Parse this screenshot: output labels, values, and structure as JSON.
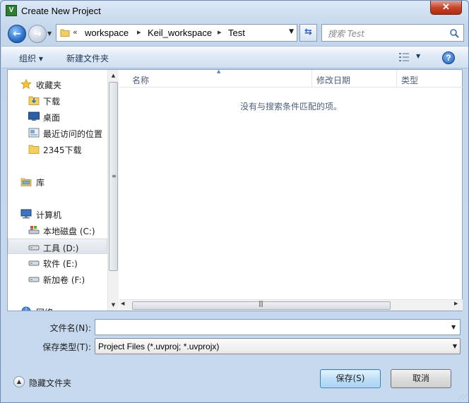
{
  "window": {
    "title": "Create New Project",
    "app_icon_text": "V",
    "close_label": "✕"
  },
  "navbar": {
    "breadcrumb_prefix": "«",
    "crumbs": [
      "workspace",
      "Keil_workspace",
      "Test"
    ],
    "crumb_separator": "▸",
    "search_placeholder": "搜索 Test"
  },
  "toolbar": {
    "organize_label": "组织 ▾",
    "new_folder_label": "新建文件夹"
  },
  "nav_pane": {
    "items": [
      {
        "label": "收藏夹",
        "icon": "star-icon"
      },
      {
        "label": "下载",
        "icon": "download-folder-icon"
      },
      {
        "label": "桌面",
        "icon": "desktop-icon"
      },
      {
        "label": "最近访问的位置",
        "icon": "recent-places-icon"
      },
      {
        "label": "2345下载",
        "icon": "folder-icon"
      },
      {
        "label": "库",
        "icon": "library-icon"
      },
      {
        "label": "计算机",
        "icon": "computer-icon"
      },
      {
        "label": "本地磁盘 (C:)",
        "icon": "system-drive-icon"
      },
      {
        "label": "工具 (D:)",
        "icon": "drive-icon"
      },
      {
        "label": "软件 (E:)",
        "icon": "drive-icon"
      },
      {
        "label": "新加卷 (F:)",
        "icon": "drive-icon"
      },
      {
        "label": "网络",
        "icon": "network-icon"
      }
    ],
    "selected_index": 8
  },
  "file_pane": {
    "columns": [
      "名称",
      "修改日期",
      "类型"
    ],
    "empty_message": "没有与搜索条件匹配的项。"
  },
  "form": {
    "filename_label": "文件名(N):",
    "filename_value": "",
    "filetype_label": "保存类型(T):",
    "filetype_value": "Project Files (*.uvproj; *.uvprojx)"
  },
  "footer": {
    "hide_folders_label": "隐藏文件夹",
    "save_label": "保存(S)",
    "cancel_label": "取消"
  }
}
